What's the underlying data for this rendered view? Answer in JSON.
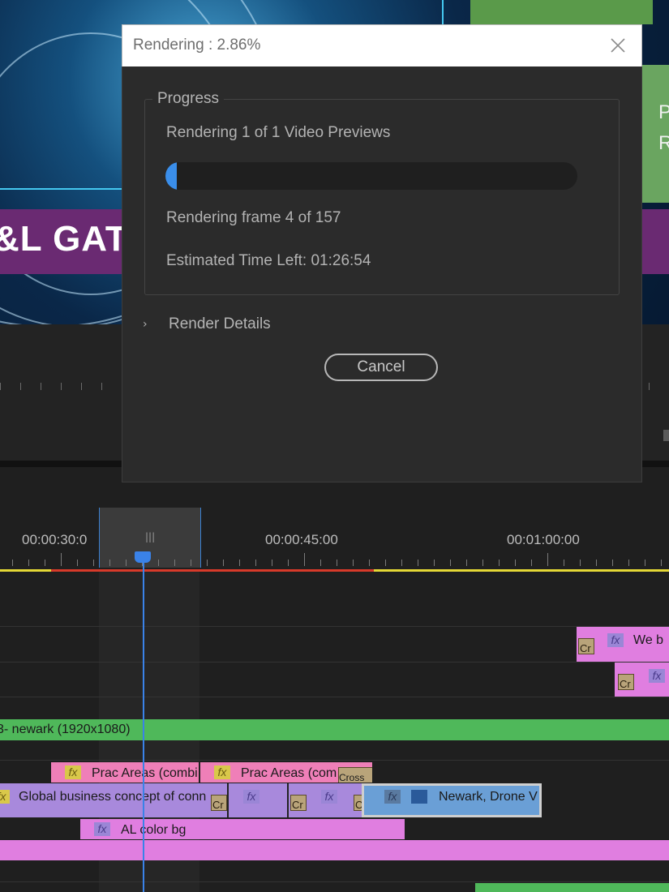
{
  "dialog": {
    "title": "Rendering : 2.86%",
    "progress_group_label": "Progress",
    "status_line": "Rendering 1 of 1 Video Previews",
    "progress_fraction": 0.0286,
    "frame_line": "Rendering frame 4 of 157",
    "time_left_line": "Estimated Time Left: 01:26:54",
    "details_label": "Render Details",
    "cancel_label": "Cancel",
    "close_icon": "close-icon",
    "chevron_icon": "chevron-right-icon"
  },
  "monitor": {
    "banner_text": "&L GATI",
    "side_text": "P\nR"
  },
  "timeline": {
    "timecodes": [
      "00:00:30:0",
      "00:00:45:00",
      "00:01:00:00"
    ],
    "clips": {
      "web": "We b",
      "newark_graphic": "3- newark (1920x1080)",
      "prac_areas_1": "Prac Areas (combi",
      "prac_areas_2": "Prac Areas (com",
      "cross": "Cross",
      "global": "Global business concept of conn",
      "newark_drone": "Newark, Drone V",
      "al_color": "AL  color bg",
      "fx": "fx",
      "cr": "Cr"
    }
  },
  "colors": {
    "accent": "#3a8eea",
    "clip_pink": "#e07ee0",
    "clip_green": "#4fb85a",
    "clip_lavender": "#a889dc",
    "clip_rose": "#ef7fb8",
    "clip_blue": "#6a9fd6"
  }
}
